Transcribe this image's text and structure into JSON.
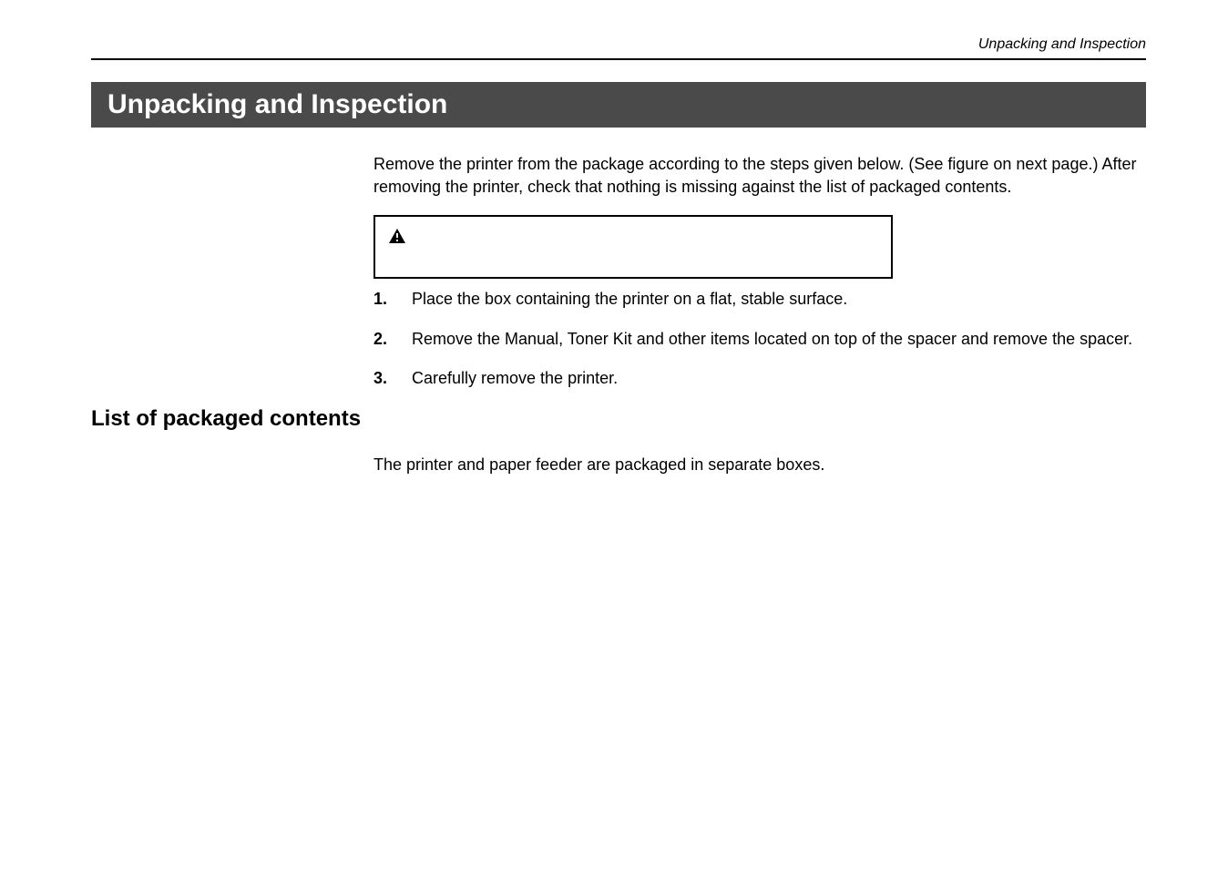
{
  "header": {
    "running_head": "Unpacking and Inspection"
  },
  "title": "Unpacking and Inspection",
  "intro": "Remove the printer from the package according to the steps given below.  (See figure on next page.)  After removing the printer, check that nothing is missing against the list of packaged contents.",
  "warning": {
    "icon_label": "⚠"
  },
  "steps": [
    {
      "num": "1.",
      "text": "Place the box containing the printer on a flat, stable surface."
    },
    {
      "num": "2.",
      "text": "Remove the           Manual, Toner Kit and other items located on top of the spacer and remove the spacer."
    },
    {
      "num": "3.",
      "text": "Carefully remove the printer."
    }
  ],
  "subheading": "List of packaged contents",
  "sub_text": "The printer and paper feeder are packaged in separate boxes."
}
